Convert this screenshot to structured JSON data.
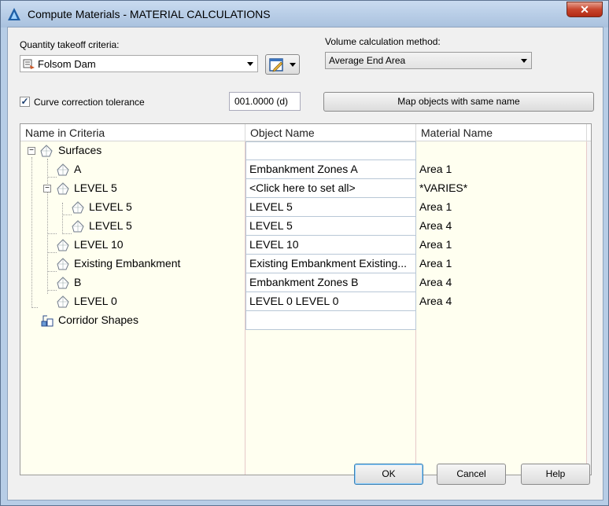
{
  "window": {
    "title": "Compute Materials - MATERIAL CALCULATIONS",
    "close_glyph": "✕"
  },
  "criteria": {
    "label": "Quantity takeoff criteria:",
    "value": "Folsom Dam"
  },
  "volume": {
    "label": "Volume calculation method:",
    "value": "Average End Area"
  },
  "curve": {
    "label": "Curve correction tolerance",
    "checked": true,
    "value": "001.0000 (d)"
  },
  "map_button": "Map objects with same name",
  "grid": {
    "headers": [
      "Name in Criteria",
      "Object Name",
      "Material Name"
    ],
    "rows": [
      {
        "name": "Surfaces",
        "object": "",
        "material": ""
      },
      {
        "name": "A",
        "object": "Embankment Zones A",
        "material": "Area 1"
      },
      {
        "name": "LEVEL 5",
        "object": "<Click here to set all>",
        "material": "*VARIES*"
      },
      {
        "name": "LEVEL 5",
        "object": "LEVEL 5",
        "material": "Area 1"
      },
      {
        "name": "LEVEL 5",
        "object": "LEVEL 5",
        "material": "Area 4"
      },
      {
        "name": "LEVEL 10",
        "object": "LEVEL 10",
        "material": "Area 1"
      },
      {
        "name": "Existing Embankment",
        "object": "Existing Embankment Existing...",
        "material": "Area 1"
      },
      {
        "name": "B",
        "object": "Embankment Zones B",
        "material": "Area 4"
      },
      {
        "name": "LEVEL 0",
        "object": "LEVEL 0 LEVEL 0",
        "material": "Area 4"
      },
      {
        "name": "Corridor Shapes",
        "object": "",
        "material": ""
      }
    ]
  },
  "buttons": {
    "ok": "OK",
    "cancel": "Cancel",
    "help": "Help"
  },
  "colors": {
    "column_fill": "#fffff0",
    "grid_border": "#9a9a9a"
  }
}
